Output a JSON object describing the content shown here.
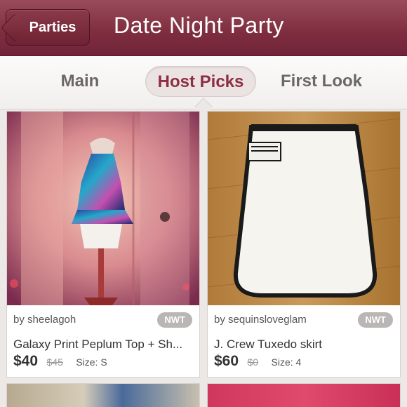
{
  "header": {
    "back_label": "Parties",
    "title": "Date Night Party"
  },
  "tabs": [
    {
      "label": "Main",
      "active": false
    },
    {
      "label": "Host Picks",
      "active": true
    },
    {
      "label": "First Look",
      "active": false
    }
  ],
  "listings": [
    {
      "seller": "by sheelagoh",
      "badge": "NWT",
      "title": "Galaxy Print Peplum Top + Sh...",
      "price": "$40",
      "original_price": "$45",
      "size": "Size: S"
    },
    {
      "seller": "by sequinsloveglam",
      "badge": "NWT",
      "title": "J. Crew Tuxedo skirt",
      "price": "$60",
      "original_price": "$0",
      "size": "Size: 4"
    }
  ],
  "colors": {
    "header": "#7d2d3e",
    "accent": "#8e2d43",
    "badge": "#b9b6b5"
  }
}
